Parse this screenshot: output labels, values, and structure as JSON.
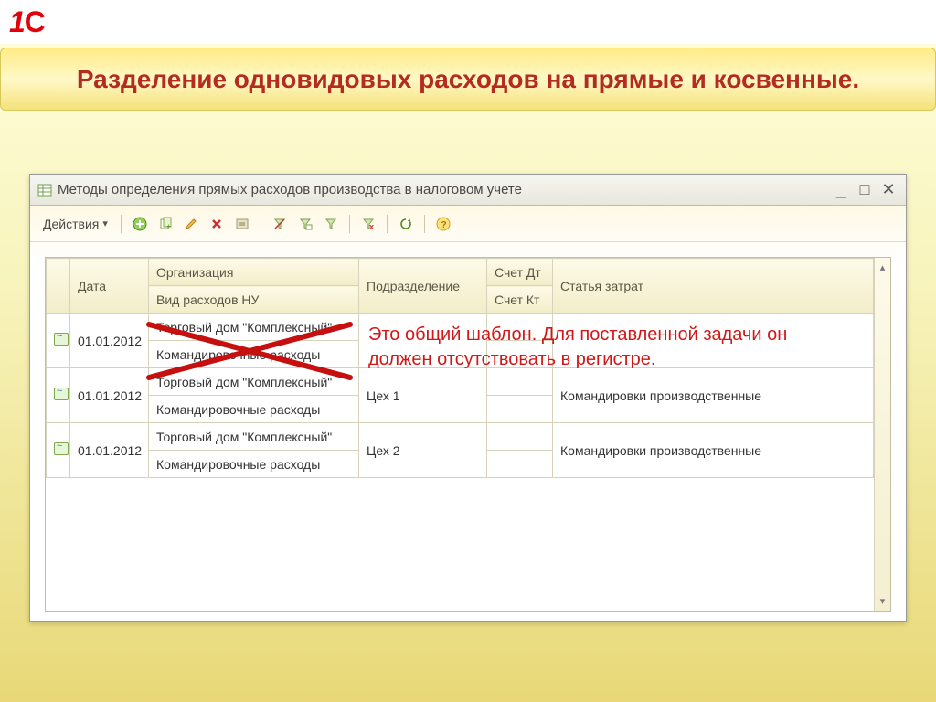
{
  "page": {
    "title": "Разделение одновидовых расходов на прямые и косвенные."
  },
  "window": {
    "title": "Методы определения прямых расходов производства в налоговом учете"
  },
  "toolbar": {
    "actions_label": "Действия"
  },
  "grid": {
    "headers": {
      "date": "Дата",
      "org": "Организация",
      "vid": "Вид расходов НУ",
      "dept": "Подразделение",
      "acc_dt": "Счет Дт",
      "acc_kt": "Счет Кт",
      "cat": "Статья затрат"
    },
    "rows": [
      {
        "date": "01.01.2012",
        "org": "Торговый дом \"Комплексный\"",
        "vid": "Командировочные расходы",
        "dept": "",
        "acc_dt": "",
        "acc_kt": "",
        "cat": ""
      },
      {
        "date": "01.01.2012",
        "org": "Торговый дом \"Комплексный\"",
        "vid": "Командировочные расходы",
        "dept": "Цех 1",
        "acc_dt": "",
        "acc_kt": "",
        "cat": "Командировки производственные"
      },
      {
        "date": "01.01.2012",
        "org": "Торговый дом \"Комплексный\"",
        "vid": "Командировочные расходы",
        "dept": "Цех 2",
        "acc_dt": "",
        "acc_kt": "",
        "cat": "Командировки производственные"
      }
    ]
  },
  "annotation": {
    "line1": "Это общий шаблон. Для поставленной задачи он",
    "line2": "должен отсутствовать в регистре."
  }
}
